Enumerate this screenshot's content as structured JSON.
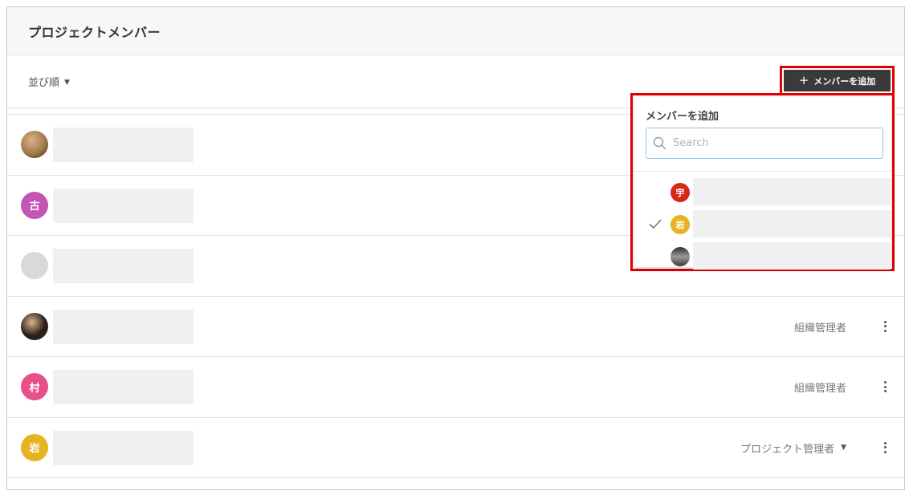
{
  "header": {
    "title": "プロジェクトメンバー"
  },
  "toolbar": {
    "sort_label": "並び順",
    "add_button_label": "メンバーを追加",
    "add_button_icon": "plus-icon"
  },
  "members": [
    {
      "avatar_type": "photo",
      "avatar_text": "",
      "avatar_color": "#a07a4a",
      "role": "",
      "role_dropdown": false,
      "show_menu": false
    },
    {
      "avatar_type": "initial",
      "avatar_text": "古",
      "avatar_color": "#c455b5",
      "role": "",
      "role_dropdown": false,
      "show_menu": false
    },
    {
      "avatar_type": "blank",
      "avatar_text": "",
      "avatar_color": "#d9d9d9",
      "role": "",
      "role_dropdown": false,
      "show_menu": false
    },
    {
      "avatar_type": "photo",
      "avatar_text": "",
      "avatar_color": "#2a1e1a",
      "role": "組織管理者",
      "role_dropdown": false,
      "show_menu": true
    },
    {
      "avatar_type": "initial",
      "avatar_text": "村",
      "avatar_color": "#e8508a",
      "role": "組織管理者",
      "role_dropdown": false,
      "show_menu": true
    },
    {
      "avatar_type": "initial",
      "avatar_text": "岩",
      "avatar_color": "#e6b422",
      "role": "プロジェクト管理者",
      "role_dropdown": true,
      "show_menu": true
    }
  ],
  "add_member_dropdown": {
    "title": "メンバーを追加",
    "search_placeholder": "Search",
    "search_value": "",
    "items": [
      {
        "avatar_text": "宇",
        "avatar_color": "#d62718",
        "checked": false
      },
      {
        "avatar_text": "岩",
        "avatar_color": "#e6b422",
        "checked": true
      },
      {
        "avatar_text": "",
        "avatar_color": "#6d6d6d",
        "checked": false
      }
    ]
  },
  "colors": {
    "highlight": "#e20000",
    "primary_button": "#3a3a3a",
    "header_bg": "#f8f7f5"
  }
}
